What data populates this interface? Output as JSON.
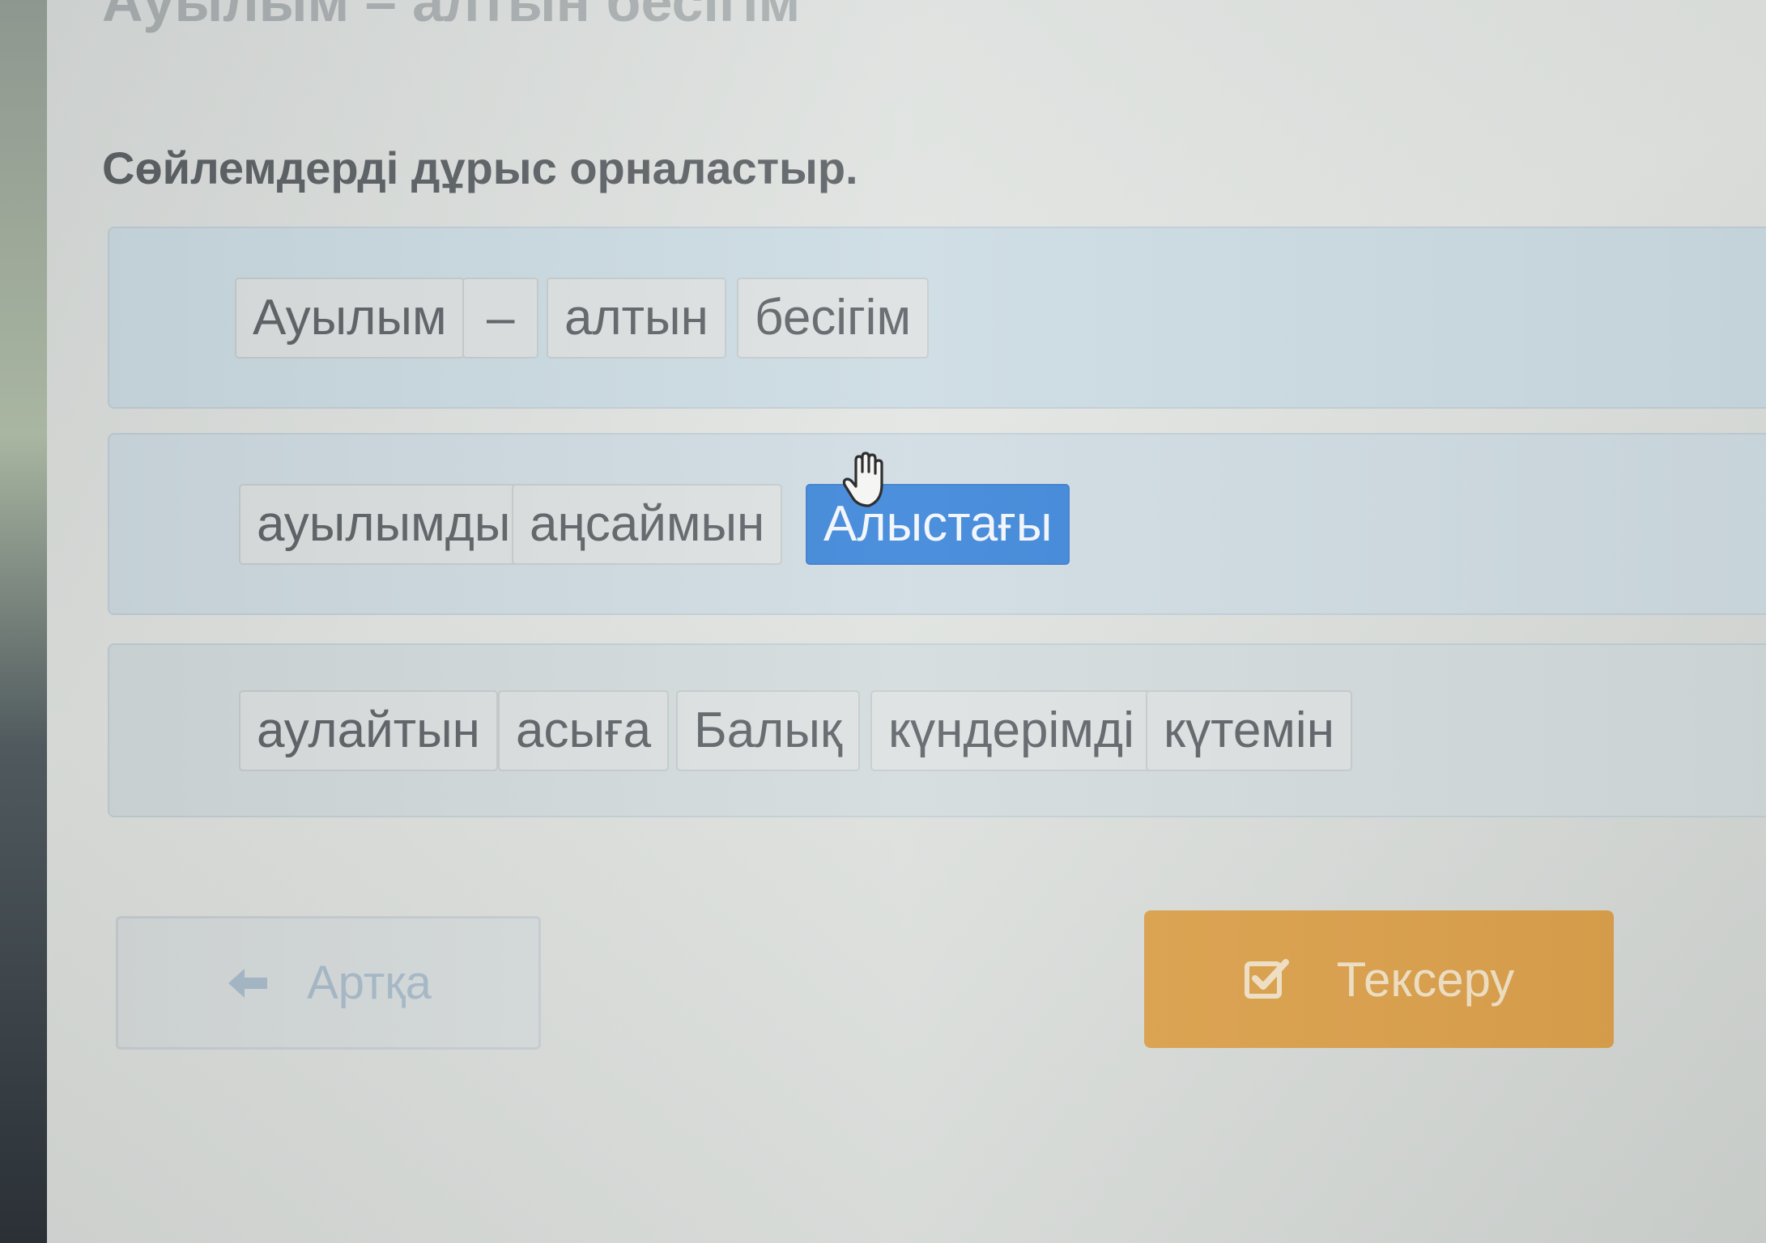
{
  "previous_title": "Ауылым – алтын бесігім",
  "instruction": "Сөйлемдерді дұрыс орналастыр.",
  "sentences": [
    {
      "words": [
        "Ауылым",
        "–",
        "алтын",
        "бесігім"
      ]
    },
    {
      "words": [
        "ауылымды",
        "аңсаймын",
        "Алыстағы"
      ]
    },
    {
      "words": [
        "аулайтын",
        "асыға",
        "Балық",
        "күндерімді",
        "күтемін"
      ]
    }
  ],
  "buttons": {
    "back_label": "Артқа",
    "check_label": "Тексеру"
  },
  "icons": {
    "back": "arrow-left-icon",
    "check": "checkbox-check-icon",
    "cursor": "hand-grab-cursor-icon"
  },
  "colors": {
    "selected_chip": "#3d86d9",
    "check_button": "#dba04a",
    "instruction_text": "#5d6266"
  }
}
